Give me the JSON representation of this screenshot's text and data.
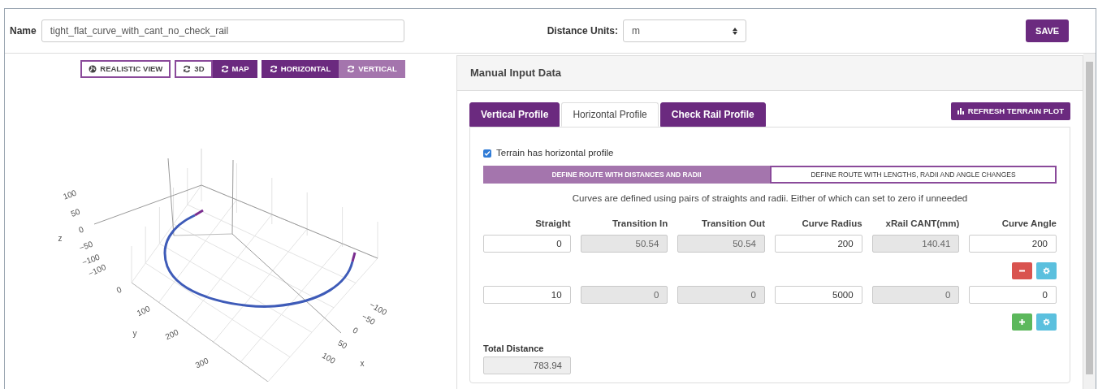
{
  "header": {
    "name_label": "Name",
    "name_value": "tight_flat_curve_with_cant_no_check_rail",
    "units_label": "Distance Units:",
    "units_value": "m",
    "save": "SAVE"
  },
  "view_groups": [
    {
      "kind": "outline",
      "buttons": [
        {
          "label": "REALISTIC VIEW",
          "kind": "globe",
          "selected": false
        }
      ]
    },
    {
      "kind": "outline",
      "buttons": [
        {
          "label": "3D",
          "kind": "refresh",
          "selected": false
        },
        {
          "label": "MAP",
          "kind": "refresh",
          "selected": true
        }
      ]
    },
    {
      "kind": "solid",
      "buttons": [
        {
          "label": "HORIZONTAL",
          "kind": "refresh",
          "selected": true
        },
        {
          "label": "VERTICAL",
          "kind": "refresh",
          "selected": false
        }
      ]
    }
  ],
  "plot": {
    "z_label": "z",
    "z_ticks": [
      "100",
      "50",
      "0",
      "−50",
      "−100"
    ],
    "y_label": "y",
    "y_ticks": [
      "−100",
      "0",
      "100",
      "200",
      "300"
    ],
    "x_label": "x",
    "x_ticks": [
      "−100",
      "−50",
      "0",
      "50",
      "100"
    ]
  },
  "panel": {
    "title": "Manual Input Data",
    "tabs": [
      {
        "label": "Vertical Profile",
        "selected": false
      },
      {
        "label": "Horizontal Profile",
        "selected": true
      },
      {
        "label": "Check Rail Profile",
        "selected": false
      }
    ],
    "refresh": "REFRESH TERRAIN PLOT",
    "terrain_checkbox": {
      "label": "Terrain has horizontal profile",
      "checked": true
    },
    "route_modes": [
      {
        "label": "DEFINE ROUTE WITH DISTANCES AND RADII",
        "selected": true
      },
      {
        "label": "DEFINE ROUTE WITH LENGTHS, RADII AND ANGLE CHANGES",
        "selected": false
      }
    ],
    "hint": "Curves are defined using pairs of straights and radii. Either of which can set to zero if unneeded",
    "columns": [
      "Straight",
      "Transition In",
      "Transition Out",
      "Curve Radius",
      "xRail CANT(mm)",
      "Curve Angle"
    ],
    "rows": [
      {
        "cells": [
          {
            "value": "0",
            "disabled": false
          },
          {
            "value": "50.54",
            "disabled": true
          },
          {
            "value": "50.54",
            "disabled": true
          },
          {
            "value": "200",
            "disabled": false
          },
          {
            "value": "140.41",
            "disabled": true
          },
          {
            "value": "200",
            "disabled": false
          }
        ],
        "actions": [
          {
            "kind": "remove"
          },
          {
            "kind": "settings"
          }
        ]
      },
      {
        "cells": [
          {
            "value": "10",
            "disabled": false
          },
          {
            "value": "0",
            "disabled": true
          },
          {
            "value": "0",
            "disabled": true
          },
          {
            "value": "5000",
            "disabled": false
          },
          {
            "value": "0",
            "disabled": true
          },
          {
            "value": "0",
            "disabled": false
          }
        ],
        "actions": [
          {
            "kind": "add"
          },
          {
            "kind": "settings"
          }
        ]
      }
    ],
    "total": {
      "label": "Total Distance",
      "value": "783.94"
    }
  }
}
